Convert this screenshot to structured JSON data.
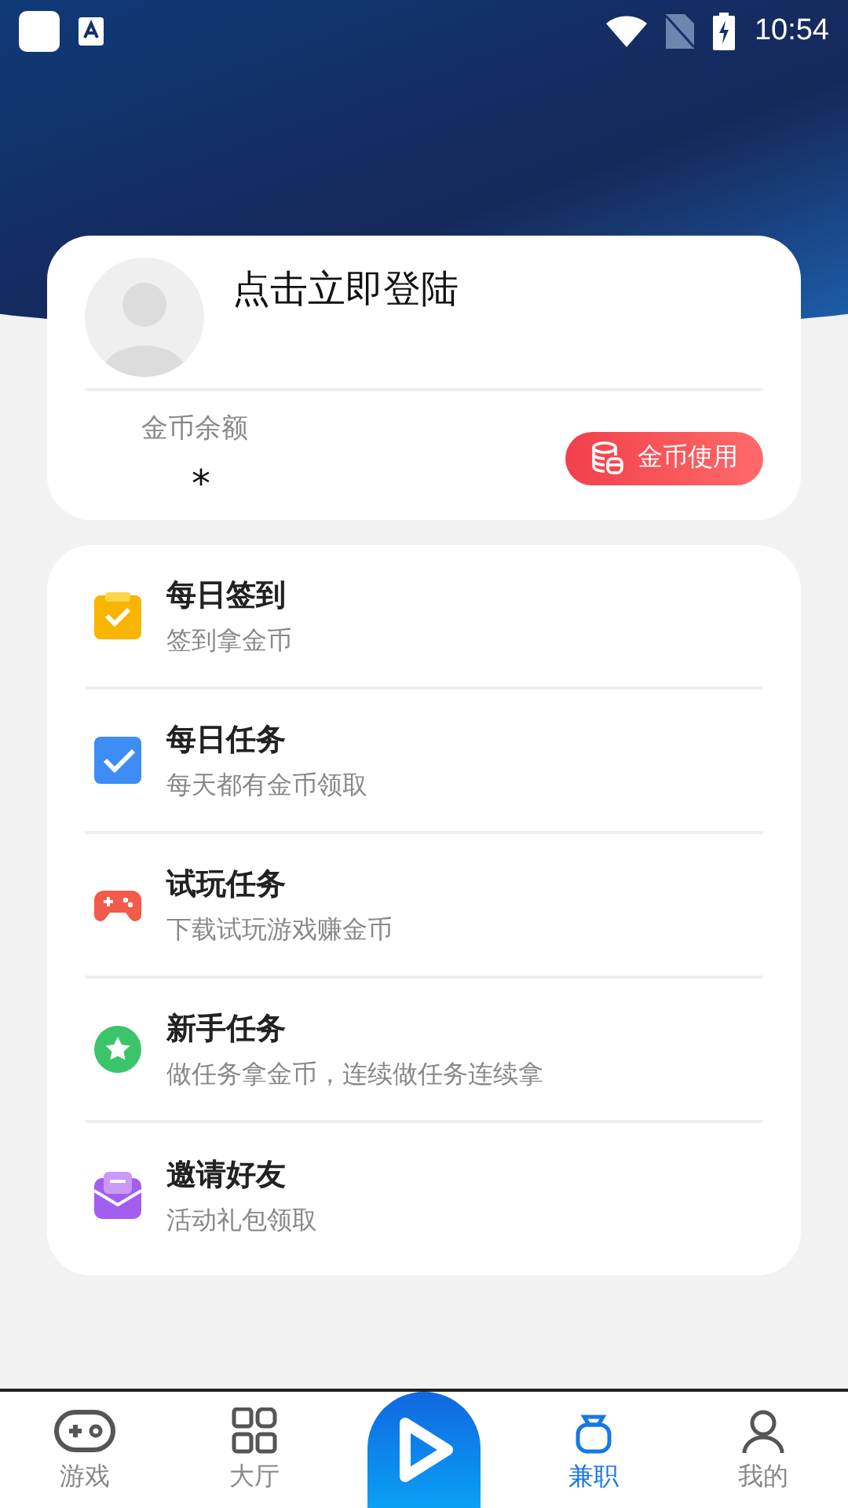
{
  "status_bar": {
    "time": "10:54"
  },
  "profile": {
    "login_prompt": "点击立即登陆",
    "balance_label": "金币余额",
    "balance_value": "*",
    "coin_button": "金币使用"
  },
  "tasks": [
    {
      "kind": "signin",
      "title": "每日签到",
      "subtitle": "签到拿金币"
    },
    {
      "kind": "daily",
      "title": "每日任务",
      "subtitle": "每天都有金币领取"
    },
    {
      "kind": "game",
      "title": "试玩任务",
      "subtitle": "下载试玩游戏赚金币"
    },
    {
      "kind": "newbie",
      "title": "新手任务",
      "subtitle": "做任务拿金币，连续做任务连续拿"
    },
    {
      "kind": "invite",
      "title": "邀请好友",
      "subtitle": "活动礼包领取"
    }
  ],
  "bottom_nav": [
    {
      "kind": "gamepad",
      "label": "游戏",
      "selected": false
    },
    {
      "kind": "grid",
      "label": "大厅",
      "selected": false
    },
    {
      "kind": "play"
    },
    {
      "kind": "parttime",
      "label": "兼职",
      "selected": true
    },
    {
      "kind": "person",
      "label": "我的",
      "selected": false
    }
  ]
}
